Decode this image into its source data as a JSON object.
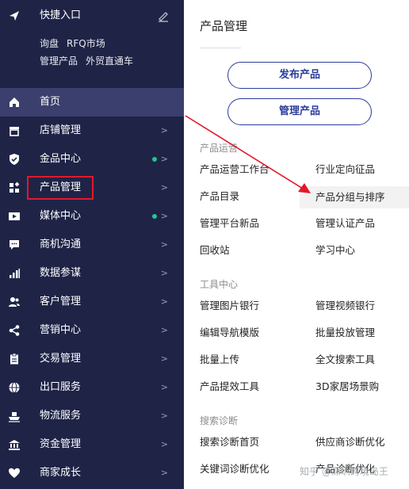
{
  "quick_entry": {
    "title": "快捷入口",
    "icon": "send-icon",
    "edit_icon": "edit-icon",
    "links_row1": [
      "询盘",
      "RFQ市场"
    ],
    "links_row2": [
      "管理产品",
      "外贸直通车"
    ]
  },
  "nav": [
    {
      "label": "首页",
      "icon": "home-icon",
      "arrow": "",
      "dot": false,
      "active": true
    },
    {
      "label": "店铺管理",
      "icon": "store-icon",
      "arrow": ">",
      "dot": false
    },
    {
      "label": "金品中心",
      "icon": "shield-icon",
      "arrow": ">",
      "dot": true
    },
    {
      "label": "产品管理",
      "icon": "apps-icon",
      "arrow": ">",
      "dot": false,
      "boxed": true
    },
    {
      "label": "媒体中心",
      "icon": "video-icon",
      "arrow": ">",
      "dot": true
    },
    {
      "label": "商机沟通",
      "icon": "chat-icon",
      "arrow": ">",
      "dot": false
    },
    {
      "label": "数据参谋",
      "icon": "chart-icon",
      "arrow": ">",
      "dot": false
    },
    {
      "label": "客户管理",
      "icon": "users-icon",
      "arrow": ">",
      "dot": false
    },
    {
      "label": "营销中心",
      "icon": "share-icon",
      "arrow": ">",
      "dot": false
    },
    {
      "label": "交易管理",
      "icon": "clipboard-icon",
      "arrow": ">",
      "dot": false
    },
    {
      "label": "出口服务",
      "icon": "globe-icon",
      "arrow": ">",
      "dot": false
    },
    {
      "label": "物流服务",
      "icon": "ship-icon",
      "arrow": ">",
      "dot": false
    },
    {
      "label": "资金管理",
      "icon": "bank-icon",
      "arrow": ">",
      "dot": false
    },
    {
      "label": "商家成长",
      "icon": "heart-icon",
      "arrow": ">",
      "dot": false
    }
  ],
  "panel": {
    "title": "产品管理",
    "buttons": [
      "发布产品",
      "管理产品"
    ],
    "sections": [
      {
        "title": "产品运营",
        "links": [
          "产品运营工作台",
          "行业定向征品",
          "产品目录",
          "产品分组与排序",
          "管理平台新品",
          "管理认证产品",
          "回收站",
          "学习中心"
        ]
      },
      {
        "title": "工具中心",
        "links": [
          "管理图片银行",
          "管理视频银行",
          "编辑导航模版",
          "批量投放管理",
          "批量上传",
          "全文搜索工具",
          "产品提效工具",
          "3D家居场景购"
        ]
      },
      {
        "title": "搜索诊断",
        "links": [
          "搜索诊断首页",
          "供应商诊断优化",
          "关键词诊断优化",
          "产品诊断优化"
        ]
      }
    ]
  },
  "watermark": "知乎 @深圳跨境岛王",
  "colors": {
    "sidebar_bg": "#1f2447",
    "active_bg": "#3a3f6d",
    "button_border": "#2a3d9b",
    "highlight_red": "#e3182a",
    "dot_green": "#25c48d"
  }
}
